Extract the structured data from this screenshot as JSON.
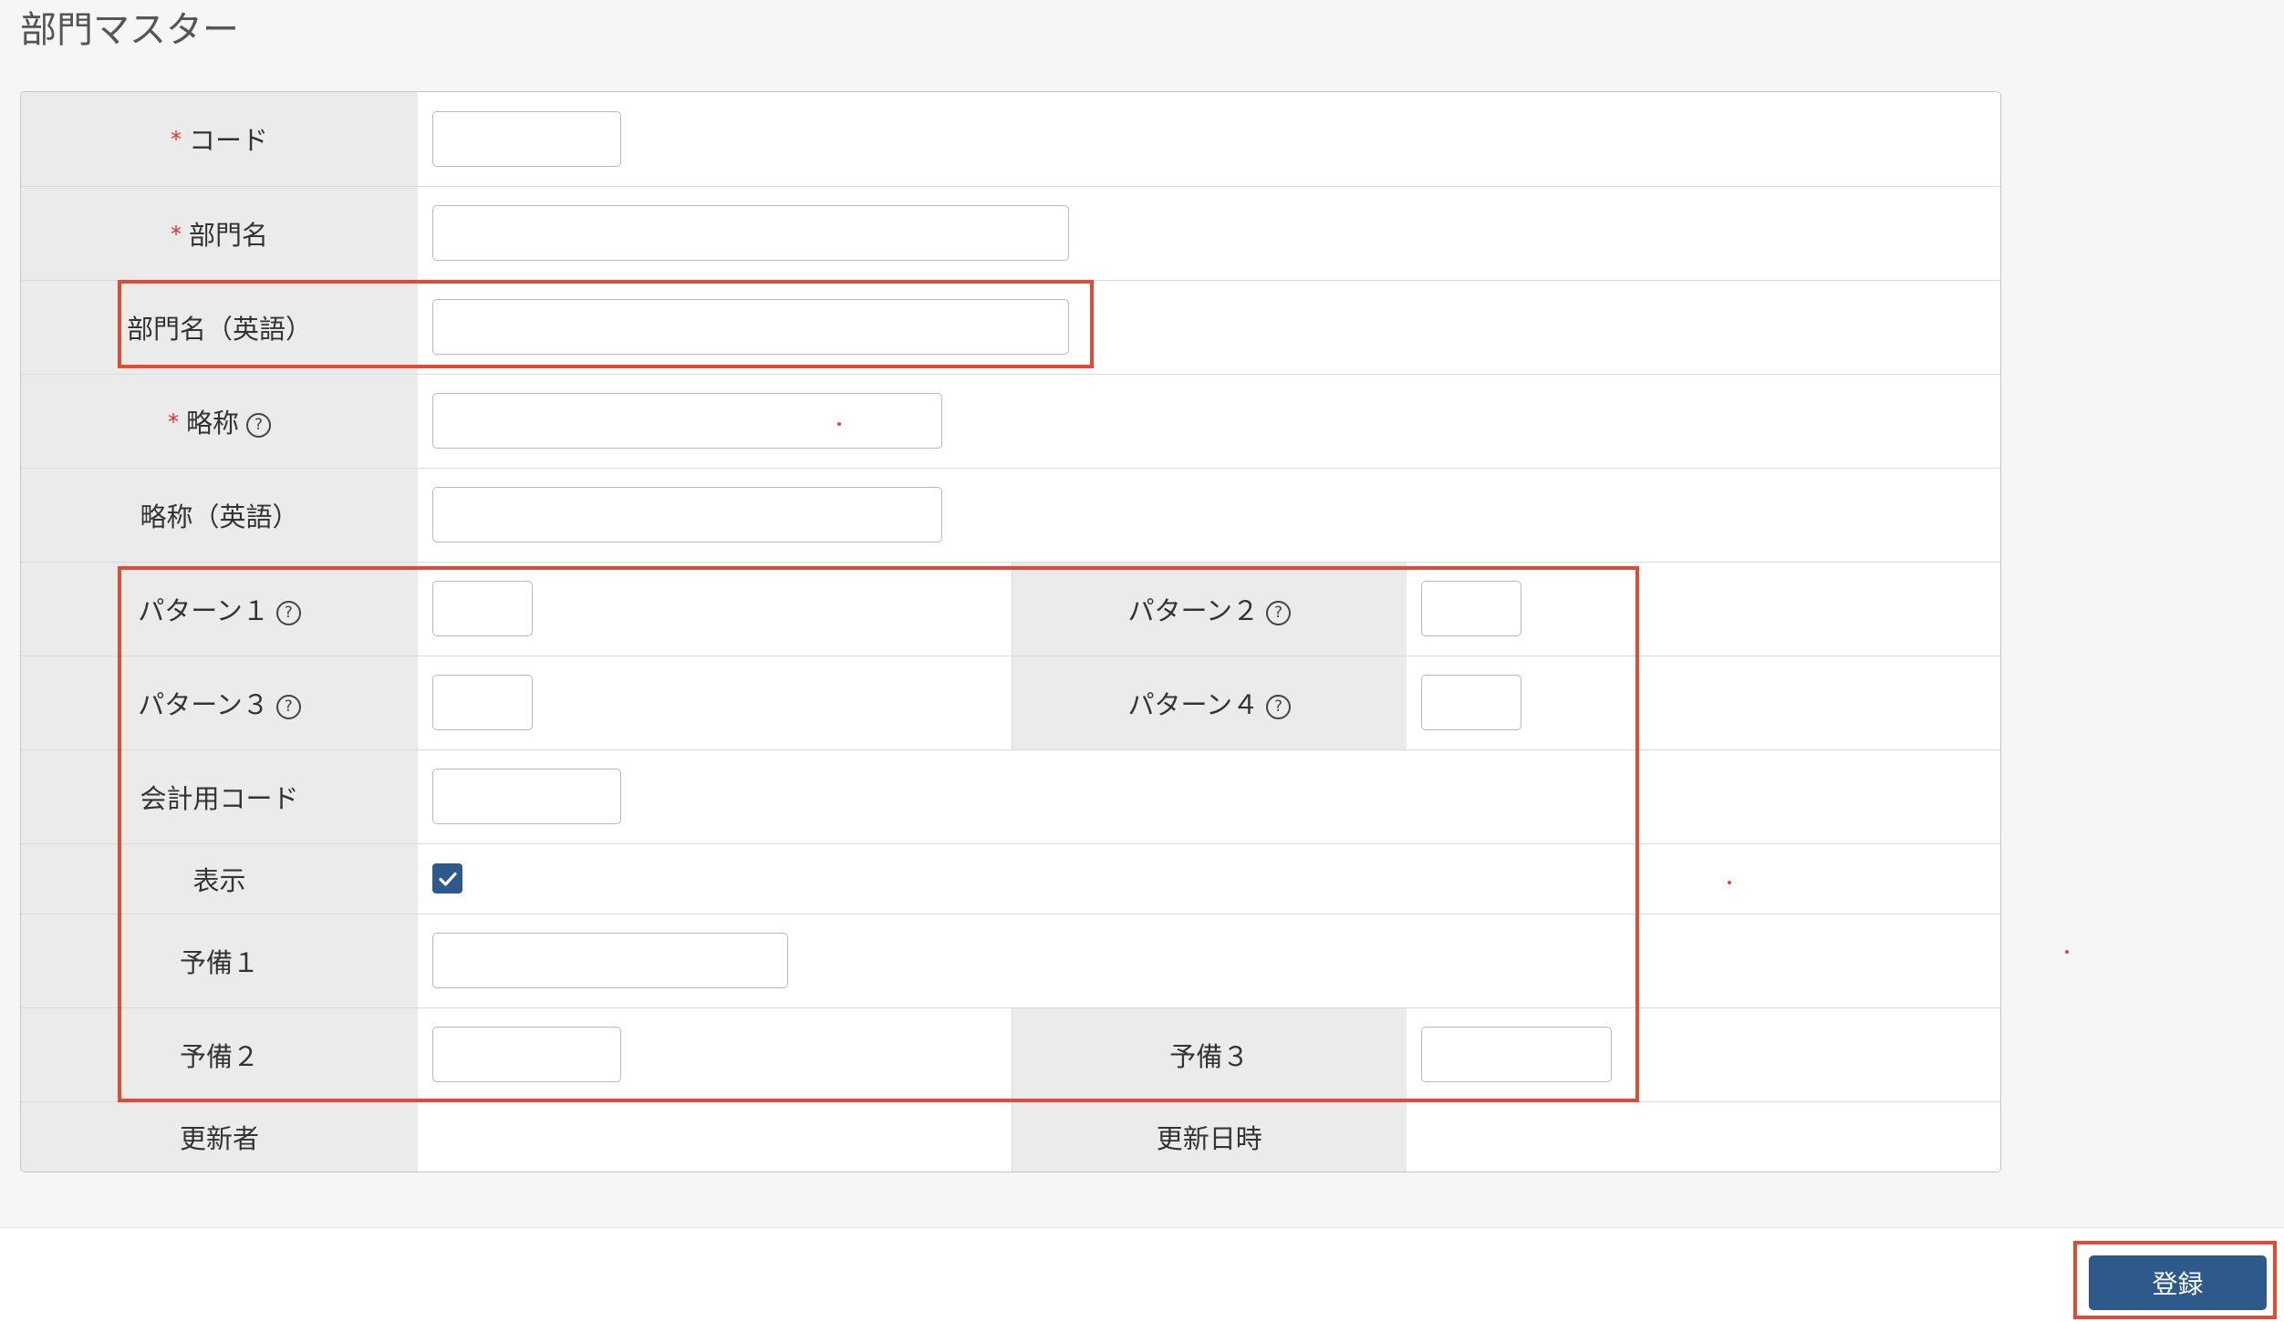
{
  "page": {
    "title": "部門マスター"
  },
  "required_mark": "*",
  "help_glyph": "?",
  "fields": {
    "code": {
      "label": "コード",
      "required": true,
      "value": ""
    },
    "name": {
      "label": "部門名",
      "required": true,
      "value": ""
    },
    "name_en": {
      "label": "部門名（英語）",
      "required": false,
      "value": ""
    },
    "abbr": {
      "label": "略称",
      "required": true,
      "help": true,
      "value": ""
    },
    "abbr_en": {
      "label": "略称（英語）",
      "required": false,
      "value": ""
    },
    "pattern1": {
      "label": "パターン１",
      "help": true,
      "value": ""
    },
    "pattern2": {
      "label": "パターン２",
      "help": true,
      "value": ""
    },
    "pattern3": {
      "label": "パターン３",
      "help": true,
      "value": ""
    },
    "pattern4": {
      "label": "パターン４",
      "help": true,
      "value": ""
    },
    "accounting_code": {
      "label": "会計用コード",
      "value": ""
    },
    "display": {
      "label": "表示",
      "checked": true
    },
    "reserve1": {
      "label": "予備１",
      "value": ""
    },
    "reserve2": {
      "label": "予備２",
      "value": ""
    },
    "reserve3": {
      "label": "予備３",
      "value": ""
    },
    "updated_by": {
      "label": "更新者",
      "value": ""
    },
    "updated_at": {
      "label": "更新日時",
      "value": ""
    }
  },
  "footer": {
    "submit_label": "登録"
  },
  "icons": {
    "help": "help-circle-icon",
    "check": "check-icon"
  },
  "colors": {
    "required": "#e0302a",
    "primary_button": "#2d5a8a",
    "checkbox": "#2d5a8a",
    "label_background": "#ebebeb",
    "page_background": "#f6f6f6",
    "annotation": "#e24a33"
  }
}
